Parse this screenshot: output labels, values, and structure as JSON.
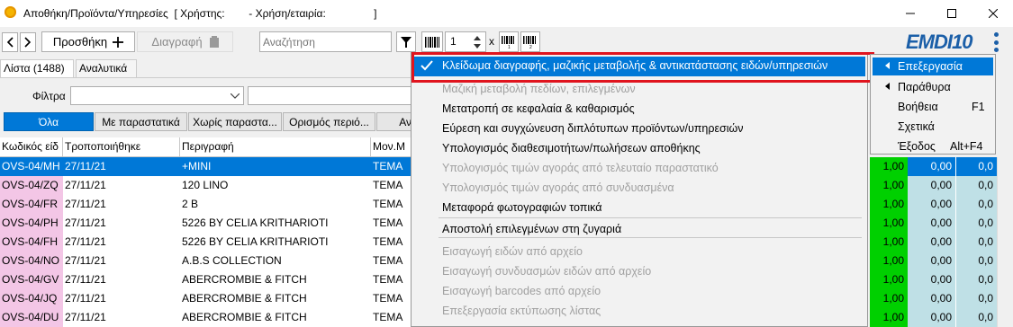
{
  "window": {
    "title": "Αποθήκη/Προϊόντα/Υπηρεσίες  [ Χρήστης:        - Χρήση/εταιρία:                ]"
  },
  "toolbar": {
    "add_label": "Προσθήκη",
    "delete_label": "Διαγραφή",
    "search_placeholder": "Αναζήτηση",
    "qty_value": "1",
    "times_label": "x",
    "logo_text": "EMDI10"
  },
  "tabs": [
    {
      "label": "Λίστα (1488)"
    },
    {
      "label": "Αναλυτικά"
    }
  ],
  "filter": {
    "label": "Φίλτρα"
  },
  "filter_buttons": [
    {
      "label": "Όλα"
    },
    {
      "label": "Με παραστατικά"
    },
    {
      "label": "Χωρίς παραστα..."
    },
    {
      "label": "Ορισμός περιό..."
    },
    {
      "label": "Αν"
    }
  ],
  "grid": {
    "columns": [
      "Κωδικός είδ",
      "Τροποποιήθηκε",
      "Περιγραφή",
      "Μον.Μ"
    ],
    "rows": [
      {
        "code": "OVS-04/MH",
        "date": "27/11/21",
        "desc": "+MINI",
        "unit": "TEMA",
        "qty": "1,00",
        "v1": "0,00",
        "v2": "0,0"
      },
      {
        "code": "OVS-04/ZQ",
        "date": "27/11/21",
        "desc": "120 LINO",
        "unit": "TEMA",
        "qty": "1,00",
        "v1": "0,00",
        "v2": "0,0"
      },
      {
        "code": "OVS-04/FR",
        "date": "27/11/21",
        "desc": "2 B",
        "unit": "TEMA",
        "qty": "1,00",
        "v1": "0,00",
        "v2": "0,0"
      },
      {
        "code": "OVS-04/PH",
        "date": "27/11/21",
        "desc": "5226 BY CELIA KRITHARIOTI",
        "unit": "TEMA",
        "qty": "1,00",
        "v1": "0,00",
        "v2": "0,0"
      },
      {
        "code": "OVS-04/FH",
        "date": "27/11/21",
        "desc": "5226 BY CELIA KRITHARIOTI",
        "unit": "TEMA",
        "qty": "1,00",
        "v1": "0,00",
        "v2": "0,0"
      },
      {
        "code": "OVS-04/NO",
        "date": "27/11/21",
        "desc": "A.B.S COLLECTION",
        "unit": "TEMA",
        "qty": "1,00",
        "v1": "0,00",
        "v2": "0,0"
      },
      {
        "code": "OVS-04/GV",
        "date": "27/11/21",
        "desc": "ABERCROMBIE & FITCH",
        "unit": "TEMA",
        "qty": "1,00",
        "v1": "0,00",
        "v2": "0,0"
      },
      {
        "code": "OVS-04/JQ",
        "date": "27/11/21",
        "desc": "ABERCROMBIE & FITCH",
        "unit": "TEMA",
        "qty": "1,00",
        "v1": "0,00",
        "v2": "0,0"
      },
      {
        "code": "OVS-04/DU",
        "date": "27/11/21",
        "desc": "ABERCROMBIE & FITCH",
        "unit": "TEMA",
        "qty": "1,00",
        "v1": "0,00",
        "v2": "0,0"
      }
    ]
  },
  "menu": {
    "items": [
      {
        "label": "Κλείδωμα διαγραφής, μαζικής μεταβολής & αντικατάστασης ειδών/υπηρεσιών",
        "checked": true
      },
      {
        "label": "Μαζική μεταβολή πεδίων, επιλεγμένων",
        "disabled": true
      },
      {
        "label": "Μετατροπή σε κεφαλαία & καθαρισμός"
      },
      {
        "label": "Εύρεση και συγχώνευση διπλότυπων προϊόντων/υπηρεσιών"
      },
      {
        "label": "Υπολογισμός διαθεσιμοτήτων/πωλήσεων αποθήκης"
      },
      {
        "label": "Υπολογισμός τιμών αγοράς από τελευταίο παραστατικό",
        "disabled": true
      },
      {
        "label": "Υπολογισμός τιμών αγοράς από συνδυασμένα",
        "disabled": true
      },
      {
        "label": "Μεταφορά φωτογραφιών τοπικά"
      },
      {
        "label": "Αποστολή επιλεγμένων στη ζυγαριά"
      },
      {
        "label": "Εισαγωγή ειδών από αρχείο",
        "disabled": true
      },
      {
        "label": "Εισαγωγή συνδυασμών ειδών από αρχείο",
        "disabled": true
      },
      {
        "label": "Εισαγωγή barcodes από αρχείο",
        "disabled": true
      },
      {
        "label": "Επεξεργασία εκτύπωσης λίστας",
        "disabled": true
      }
    ]
  },
  "submenu": {
    "items": [
      {
        "label": "Επεξεργασία",
        "shortcut": ""
      },
      {
        "label": "Παράθυρα",
        "shortcut": ""
      },
      {
        "label": "Βοήθεια",
        "shortcut": "F1"
      },
      {
        "label": "Σχετικά",
        "shortcut": ""
      },
      {
        "label": "Έξοδος",
        "shortcut": "Alt+F4"
      }
    ]
  },
  "colors": {
    "accent": "#0078d7",
    "highlight_border": "#e0141e",
    "qty_green": "#00d000",
    "code_pink": "#f3c6e6",
    "grid_teal": "#bfe0e6"
  }
}
